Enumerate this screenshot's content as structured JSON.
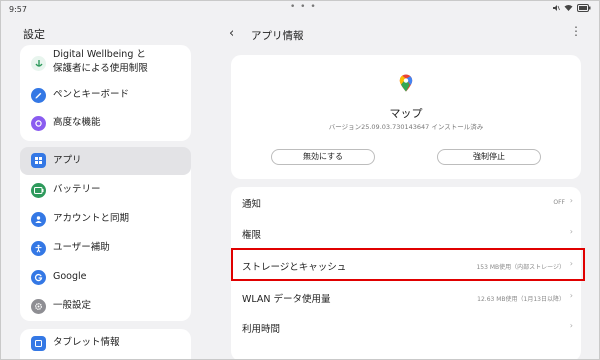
{
  "status": {
    "time": "9:57",
    "dots": "• • •"
  },
  "sidebar": {
    "title": "設定",
    "items": [
      {
        "label": "Digital Wellbeing と",
        "label2": "保護者による使用制限",
        "icon": "wellbeing-icon",
        "color": "#2e9a5c"
      },
      {
        "label": "ペンとキーボード",
        "icon": "pen-icon",
        "color": "#3478e5"
      },
      {
        "label": "高度な機能",
        "icon": "advanced-icon",
        "color": "#8a5cf0"
      },
      {
        "label": "アプリ",
        "icon": "apps-icon",
        "color": "#3478e5"
      },
      {
        "label": "バッテリー",
        "icon": "battery-icon",
        "color": "#2e9a5c"
      },
      {
        "label": "アカウントと同期",
        "icon": "account-icon",
        "color": "#3478e5"
      },
      {
        "label": "ユーザー補助",
        "icon": "accessibility-icon",
        "color": "#3478e5"
      },
      {
        "label": "Google",
        "icon": "google-icon",
        "color": "#3478e5"
      },
      {
        "label": "一般設定",
        "icon": "general-settings-icon",
        "color": "#8e8e93"
      },
      {
        "label": "タブレット情報",
        "icon": "tablet-icon",
        "color": "#3478e5"
      }
    ]
  },
  "header": {
    "back": "‹",
    "title": "アプリ情報",
    "more": "⋮"
  },
  "app": {
    "name": "マップ",
    "version": "バージョン25.09.03.730143647 インストール済み",
    "disable_label": "無効にする",
    "force_stop_label": "強制停止"
  },
  "rows": [
    {
      "title": "通知",
      "value": "OFF"
    },
    {
      "title": "権限",
      "value": ""
    },
    {
      "title": "ストレージとキャッシュ",
      "value": "153 MB使用（内部ストレージ）"
    },
    {
      "title": "WLAN データ使用量",
      "value": "12.63 MB使用（1月13日以降）"
    },
    {
      "title": "利用時間",
      "value": ""
    }
  ],
  "colors": {
    "highlight": "#e00000",
    "accent": "#3478e5"
  }
}
